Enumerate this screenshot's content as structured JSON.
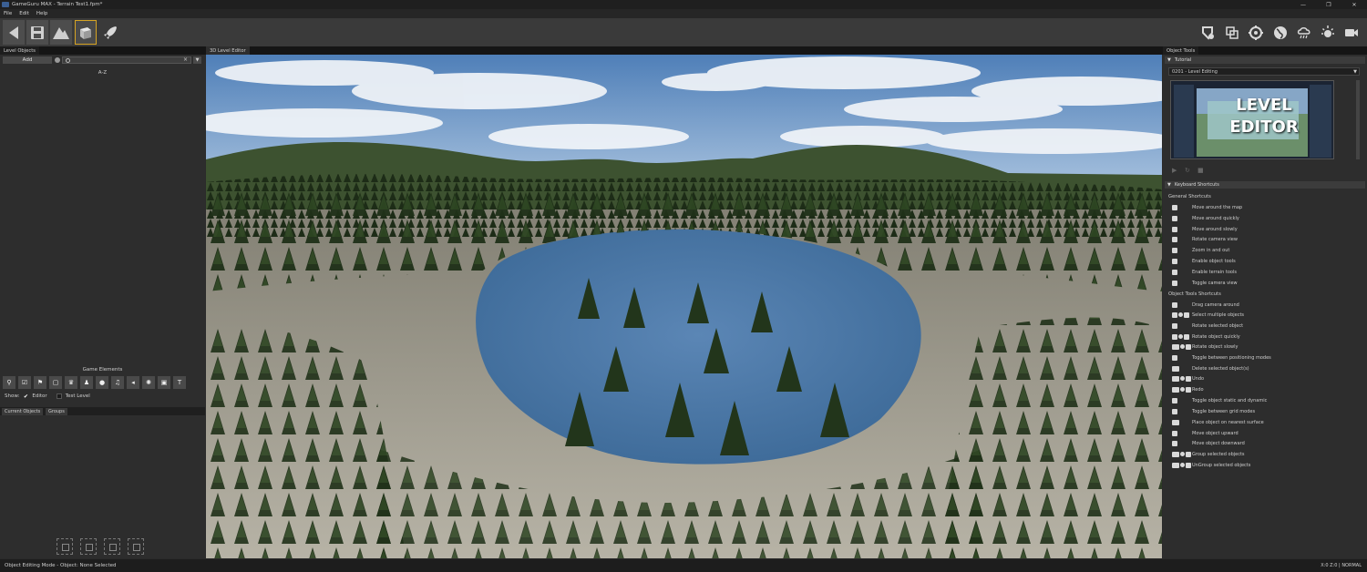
{
  "window": {
    "title": "GameGuru MAX - Terrain Test1.fpm*",
    "controls": [
      "—",
      "❐",
      "✕"
    ]
  },
  "menu": [
    "File",
    "Edit",
    "Help"
  ],
  "toolbar": {
    "left_icons": [
      "back-icon",
      "save-icon",
      "terrain-icon",
      "object-cube-icon",
      "test-game-rocket-icon"
    ],
    "right_icons": [
      "marker-tool-icon",
      "grid-tool-icon",
      "target-icon",
      "globe-icon",
      "weather-icon",
      "lighting-icon",
      "camera-icon"
    ]
  },
  "left_panel": {
    "tab": "Level Objects",
    "add_label": "Add",
    "az_label": "A-Z",
    "game_elements_label": "Game Elements",
    "show_label": "Show:",
    "editor_label": "Editor",
    "test_level_label": "Test Level",
    "tabs": [
      "Current Objects",
      "Groups"
    ]
  },
  "viewport": {
    "tab": "3D Level Editor"
  },
  "right_panel": {
    "tab": "Object Tools",
    "tutorial": {
      "header": "Tutorial",
      "selected": "0201 - Level Editing",
      "thumb_line1": "LEVEL",
      "thumb_line2": "EDITOR"
    },
    "shortcuts": {
      "header": "Keyboard Shortcuts",
      "general_title": "General Shortcuts",
      "general": [
        "Move around the map",
        "Move around quickly",
        "Move around slowly",
        "Rotate camera view",
        "Zoom in and out",
        "Enable object tools",
        "Enable terrain tools",
        "Toggle camera view"
      ],
      "object_title": "Object Tools Shortcuts",
      "object": [
        "Drag camera around",
        "Select multiple objects",
        "Rotate selected object",
        "Rotate object quickly",
        "Rotate object slowly",
        "Toggle between positioning modes",
        "Delete selected object(s)",
        "Undo",
        "Redo",
        "Toggle object static and dynamic",
        "Toggle between grid modes",
        "Place object on nearest surface",
        "Move object upward",
        "Move object downward",
        "Group selected objects",
        "UnGroup selected objects"
      ]
    }
  },
  "status": {
    "left": "Object Editing Mode - Object: None Selected",
    "right": "X:0 Z:0  |  NORMAL"
  }
}
